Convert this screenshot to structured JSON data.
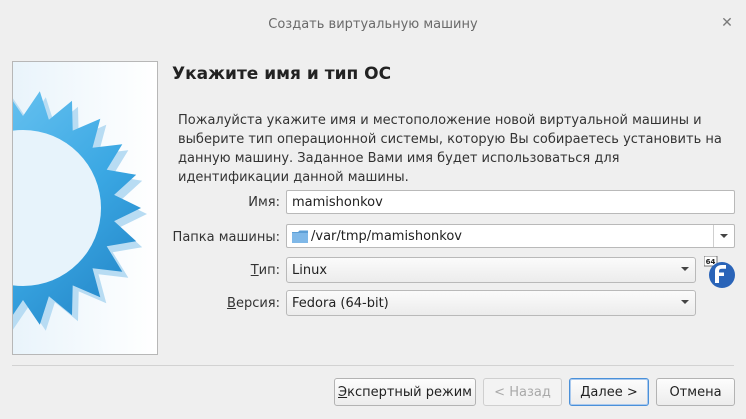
{
  "window": {
    "title": "Создать виртуальную машину",
    "close_symbol": "✕"
  },
  "page": {
    "heading": "Укажите имя и тип ОС",
    "description": "Пожалуйста укажите имя и местоположение новой виртуальной машины и выберите тип операционной системы, которую Вы собираетесь установить на данную машину. Заданное Вами имя будет использоваться для идентификации данной машины."
  },
  "form": {
    "name_label": "Имя:",
    "name_value": "mamishonkov",
    "folder_label": "Папка машины:",
    "folder_value": "/var/tmp/mamishonkov",
    "type_label_mnemonic": "Т",
    "type_label_rest": "ип:",
    "type_value": "Linux",
    "version_label_mnemonic": "В",
    "version_label_rest": "ерсия:",
    "version_value": "Fedora (64-bit)",
    "os_icon": "fedora-64-icon",
    "os_icon_badge": "64"
  },
  "buttons": {
    "expert_mnemonic": "Э",
    "expert_rest": "кспертный режим",
    "back": "< Назад",
    "next_mnemonic": "Д",
    "next_rest": "алее >",
    "cancel": "Отмена"
  },
  "colors": {
    "accent": "#4a90d9",
    "sidepanel_star": "#5bb3e8"
  }
}
